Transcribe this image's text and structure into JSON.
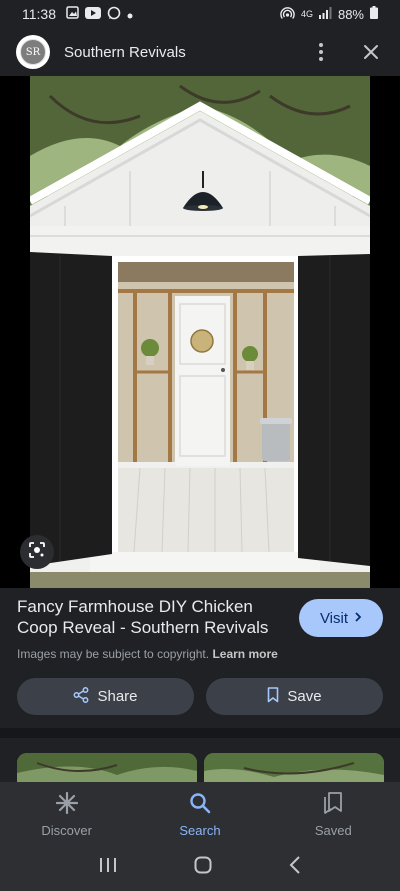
{
  "status_bar": {
    "time": "11:38",
    "network": "4G",
    "battery": "88%"
  },
  "header": {
    "avatar_text": "SR",
    "site_name": "Southern Revivals",
    "menu_icon": "more-vert-icon",
    "close_icon": "close-icon"
  },
  "result": {
    "title": "Fancy Farmhouse DIY Chicken Coop Reveal - Southern Revivals",
    "visit_label": "Visit",
    "copyright_text": "Images may be subject to copyright.",
    "learn_more": "Learn more"
  },
  "actions": {
    "share_label": "Share",
    "save_label": "Save"
  },
  "bottom_nav": {
    "items": [
      {
        "label": "Discover",
        "icon": "asterisk-icon"
      },
      {
        "label": "Search",
        "icon": "search-icon"
      },
      {
        "label": "Saved",
        "icon": "bookmarks-icon"
      }
    ],
    "active": "Search"
  },
  "colors": {
    "background": "#1f2125",
    "accent": "#a8c7fa",
    "active_nav": "#8ab4f8"
  }
}
